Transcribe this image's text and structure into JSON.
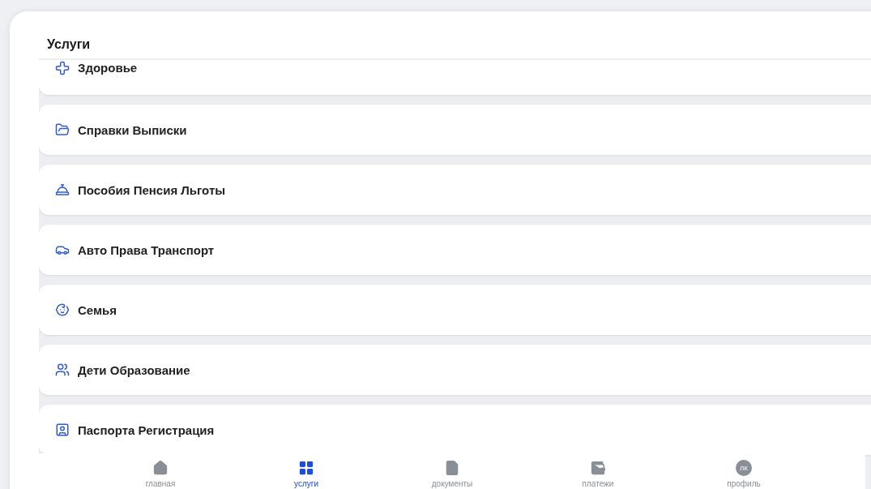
{
  "title": "Услуги",
  "services": [
    {
      "label": "Здоровье",
      "kind": "health"
    },
    {
      "label": "Справки Выписки",
      "kind": "documents"
    },
    {
      "label": "Пособия Пенсия Льготы",
      "kind": "benefits"
    },
    {
      "label": "Авто Права Транспорт",
      "kind": "auto"
    },
    {
      "label": "Семья",
      "kind": "family"
    },
    {
      "label": "Дети Образование",
      "kind": "children"
    },
    {
      "label": "Паспорта Регистрация",
      "kind": "passport"
    }
  ],
  "bottom_nav": [
    {
      "label": "главная",
      "kind": "home",
      "selected": false
    },
    {
      "label": "услуги",
      "kind": "services",
      "selected": true
    },
    {
      "label": "документы",
      "kind": "documents",
      "selected": false
    },
    {
      "label": "платежи",
      "kind": "payments",
      "selected": false
    },
    {
      "label": "профиль",
      "kind": "profile",
      "selected": false,
      "avatar_text": "ЛК"
    }
  ]
}
